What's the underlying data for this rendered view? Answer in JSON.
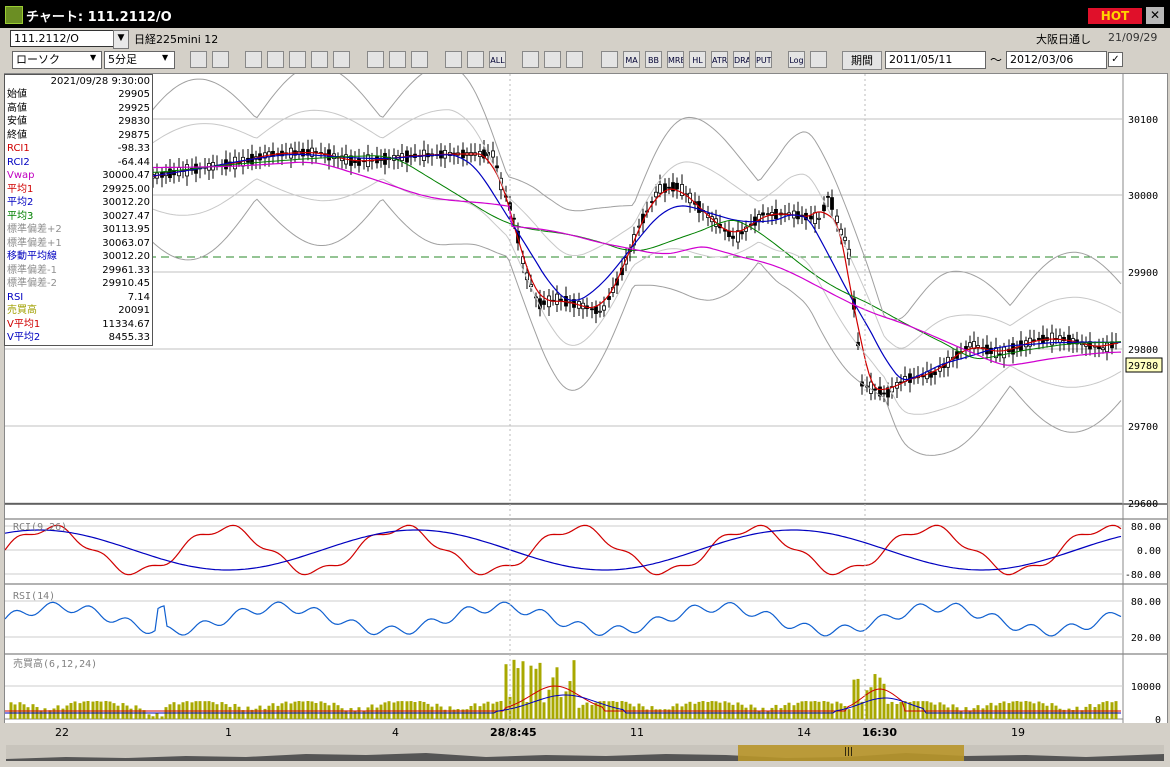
{
  "window": {
    "title": "チャート: 111.2112/O",
    "hot_label": "HOT",
    "close_label": "✕"
  },
  "toolbar": {
    "code": "111.2112/O",
    "instrument": "日経225mini 12",
    "session": "大阪日通し",
    "date": "21/09/29",
    "chart_type": "ローソク",
    "interval": "5分足",
    "period_label": "期間",
    "start_date": "2011/05/11",
    "tilde": "〜",
    "end_date": "2012/03/06",
    "tools": [
      "search-icon",
      "crosshair-icon",
      "candle-icon",
      "trend-icon",
      "bar-icon",
      "box-icon",
      "note-icon",
      "pen-icon",
      "cursor-icon",
      "arrow-icon",
      "hl-icon",
      "ohlc-icon",
      "all-icon",
      "grid-icon",
      "brush-icon",
      "palette-icon",
      "bb-icon",
      "ma-icon",
      "bb2-icon",
      "mre-icon",
      "hl2-icon",
      "atr-icon",
      "dra-icon",
      "put-icon",
      "log-icon",
      "export-icon"
    ],
    "tool_labels": [
      "",
      "",
      "",
      "",
      "",
      "",
      "",
      "",
      "",
      "",
      "",
      "",
      "ALL",
      "",
      "",
      "",
      "",
      "MA",
      "BB",
      "MRE",
      "HL",
      "ATR",
      "DRA",
      "PUT",
      "Log",
      ""
    ]
  },
  "info": {
    "datetime": "2021/09/28 9:30:00",
    "rows": [
      {
        "k": "始値",
        "v": "29905",
        "c": "#000"
      },
      {
        "k": "高値",
        "v": "29925",
        "c": "#000"
      },
      {
        "k": "安値",
        "v": "29830",
        "c": "#000"
      },
      {
        "k": "終値",
        "v": "29875",
        "c": "#000"
      },
      {
        "k": "RCI1",
        "v": "-98.33",
        "c": "#d00000"
      },
      {
        "k": "RCI2",
        "v": "-64.44",
        "c": "#0000c0"
      },
      {
        "k": "Vwap",
        "v": "30000.47",
        "c": "#c000c0"
      },
      {
        "k": "平均1",
        "v": "29925.00",
        "c": "#d00000"
      },
      {
        "k": "平均2",
        "v": "30012.20",
        "c": "#0000c0"
      },
      {
        "k": "平均3",
        "v": "30027.47",
        "c": "#008000"
      },
      {
        "k": "標準偏差+2",
        "v": "30113.95",
        "c": "#909090"
      },
      {
        "k": "標準偏差+1",
        "v": "30063.07",
        "c": "#909090"
      },
      {
        "k": "移動平均線",
        "v": "30012.20",
        "c": "#0000c0"
      },
      {
        "k": "標準偏差-1",
        "v": "29961.33",
        "c": "#909090"
      },
      {
        "k": "標準偏差-2",
        "v": "29910.45",
        "c": "#909090"
      },
      {
        "k": "RSI",
        "v": "7.14",
        "c": "#0000c0"
      },
      {
        "k": "売買高",
        "v": "20091",
        "c": "#a0a000"
      },
      {
        "k": "V平均1",
        "v": "11334.67",
        "c": "#d00000"
      },
      {
        "k": "V平均2",
        "v": "8455.33",
        "c": "#0000c0"
      }
    ]
  },
  "price_axis": {
    "ticks": [
      "30100",
      "30000",
      "29900",
      "29800",
      "29700",
      "29600"
    ],
    "current": "29780"
  },
  "rci_panel": {
    "label": "RCI(9,26)",
    "ticks": [
      "80.00",
      "0.00",
      "-80.00"
    ]
  },
  "rsi_panel": {
    "label": "RSI(14)",
    "ticks": [
      "80.00",
      "20.00"
    ]
  },
  "vol_panel": {
    "label": "売買高(6,12,24)",
    "ticks": [
      "10000",
      "0"
    ]
  },
  "xaxis": {
    "labels": [
      "22",
      "1",
      "4",
      "28/8:45",
      "11",
      "14",
      "16:30",
      "19"
    ]
  },
  "scroll": {
    "thumb_label": "|||"
  }
}
